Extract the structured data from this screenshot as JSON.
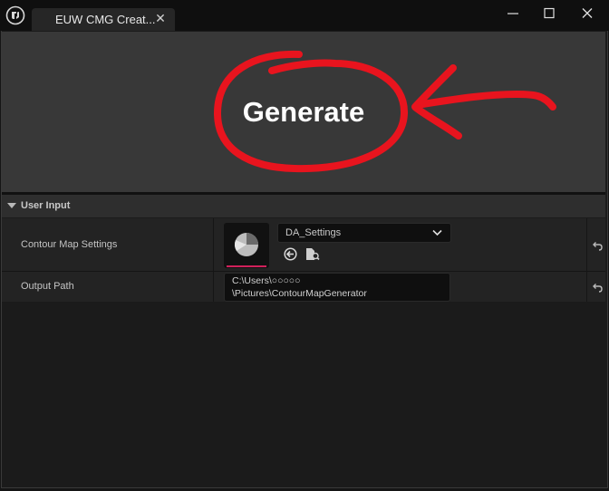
{
  "window": {
    "tab_title": "EUW CMG Creat...",
    "close_glyph": "✕",
    "controls": [
      "minimize-icon",
      "maximize-icon",
      "close-icon"
    ]
  },
  "toolbar": {
    "generate_label": "Generate",
    "annotation_color": "#e8141e"
  },
  "section": {
    "title": "User Input"
  },
  "properties": [
    {
      "label": "Contour Map Settings",
      "asset_value": "DA_Settings",
      "thumbnail_icon": "data-asset-icon",
      "actions": [
        "use-selected-icon",
        "browse-to-asset-icon"
      ]
    },
    {
      "label": "Output Path",
      "value_line1": "C:\\Users\\○○○○○",
      "value_line2": "\\Pictures\\ContourMapGenerator"
    }
  ],
  "colors": {
    "background": "#151515",
    "panel": "#383838",
    "row": "#232323",
    "thumbnail_accent": "#d0205a"
  }
}
